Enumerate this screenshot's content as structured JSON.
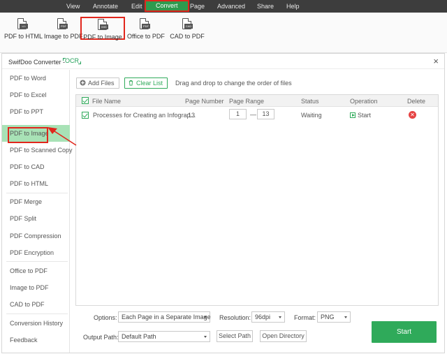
{
  "menubar": {
    "items": [
      "View",
      "Annotate",
      "Edit",
      "Convert",
      "Page",
      "Advanced",
      "Share",
      "Help"
    ],
    "active": "Convert"
  },
  "ribbon": {
    "buttons": [
      "PDF to HTML",
      "Image to PDF",
      "PDF to Image",
      "Office to PDF",
      "CAD to PDF"
    ]
  },
  "window": {
    "title": "SwifDoo Converter -",
    "ocr": "OCR",
    "close": "×"
  },
  "sidebar": {
    "items": [
      "PDF to Word",
      "PDF to Excel",
      "PDF to PPT",
      "PDF to Image",
      "PDF to Scanned Copy",
      "PDF to CAD",
      "PDF to HTML",
      "PDF Merge",
      "PDF Split",
      "PDF Compression",
      "PDF Encryption",
      "Office to PDF",
      "Image to PDF",
      "CAD to PDF",
      "Conversion History",
      "Feedback"
    ],
    "active": "PDF to Image"
  },
  "toolbar": {
    "add_files": "Add Files",
    "clear_list": "Clear List",
    "hint": "Drag and drop to change the order of files"
  },
  "table": {
    "headers": [
      "File Name",
      "Page Number",
      "Page Range",
      "Status",
      "Operation",
      "Delete"
    ],
    "rows": [
      {
        "file_name": "Processes for Creating an Infograp...",
        "page_number": "13",
        "range_from": "1",
        "range_sep": "—",
        "range_to": "13",
        "status": "Waiting",
        "operation": "Start"
      }
    ]
  },
  "options": {
    "options_label": "Options:",
    "options_value": "Each Page in a Separate Image",
    "resolution_label": "Resolution:",
    "resolution_value": "96dpi",
    "format_label": "Format:",
    "format_value": "PNG",
    "output_label": "Output Path:",
    "output_value": "Default Path",
    "select_path": "Select Path",
    "open_directory": "Open Directory",
    "start": "Start"
  },
  "colors": {
    "accent_green": "#2faa5a",
    "highlight_red": "#e1261c",
    "menubar_bg": "#3d3d3d",
    "sidebar_active": "#a8e2b6"
  }
}
